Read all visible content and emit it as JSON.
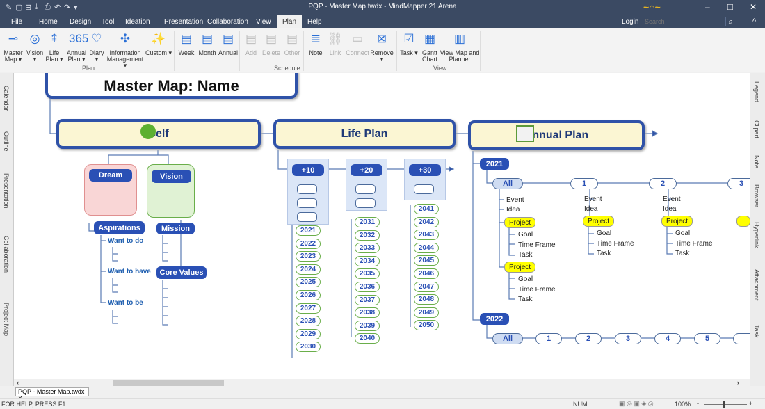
{
  "window": {
    "title": "PQP - Master Map.twdx - MindMapper 21 Arena",
    "minimize": "–",
    "maximize": "□",
    "close": "✕",
    "logo": "MindMapper logo"
  },
  "quick_access": [
    "✎",
    "▢",
    "⊟",
    "⤓",
    "⎙",
    "↶",
    "↷",
    "▾"
  ],
  "menu_tabs": [
    "File",
    "Home",
    "Design",
    "Tool",
    "Ideation",
    "Presentation",
    "Collaboration",
    "View",
    "Plan",
    "Help"
  ],
  "active_tab": "Plan",
  "header": {
    "login": "Login",
    "search_placeholder": "Search",
    "search_icon": "⌕",
    "collapse": "^"
  },
  "ribbon": {
    "plan": {
      "label": "Plan",
      "buttons": [
        {
          "label": "Master Map ▾",
          "icon": "⊸"
        },
        {
          "label": "Vision ▾",
          "icon": "◎"
        },
        {
          "label": "Life Plan ▾",
          "icon": "⇞"
        },
        {
          "label": "Annual Plan ▾",
          "icon": "365"
        },
        {
          "label": "Diary ▾",
          "icon": "♡"
        },
        {
          "label": "Information Management ▾",
          "icon": "✣"
        },
        {
          "label": "Custom ▾",
          "icon": "✨"
        }
      ]
    },
    "schedule": {
      "label": "Schedule",
      "buttons": [
        {
          "label": "Week",
          "icon": "▤",
          "enabled": true
        },
        {
          "label": "Month",
          "icon": "▤",
          "enabled": true
        },
        {
          "label": "Annual",
          "icon": "▤",
          "enabled": true
        },
        {
          "label": "Add",
          "icon": "▤",
          "enabled": false
        },
        {
          "label": "Delete",
          "icon": "▤",
          "enabled": false
        },
        {
          "label": "Other",
          "icon": "▤",
          "enabled": false
        },
        {
          "label": "Note",
          "icon": "≣",
          "enabled": true
        },
        {
          "label": "Link",
          "icon": "⛓",
          "enabled": false
        },
        {
          "label": "Connect",
          "icon": "▭",
          "enabled": false
        },
        {
          "label": "Remove ▾",
          "icon": "⊠",
          "enabled": true
        }
      ]
    },
    "view": {
      "label": "View",
      "buttons": [
        {
          "label": "Task ▾",
          "icon": "☑"
        },
        {
          "label": "Gantt Chart",
          "icon": "▦"
        },
        {
          "label": "View Map and Planner",
          "icon": "▥"
        }
      ]
    }
  },
  "left_panel": [
    "Calendar",
    "Outline",
    "Presentation",
    "Collaboration",
    "Project Map"
  ],
  "right_panel": [
    "Legend",
    "Clipart",
    "Note",
    "Browser",
    "Hyperlink",
    "Attachment",
    "Task"
  ],
  "map": {
    "title": "Master Map: Name",
    "self": {
      "label": "Self",
      "dream": "Dream",
      "vision": "Vision",
      "aspirations": "Aspirations",
      "mission": "Mission",
      "core_values": "Core Values",
      "wants": [
        "Want to do",
        "Want to have",
        "Want to be"
      ]
    },
    "life_plan": {
      "label": "Life Plan",
      "columns": [
        {
          "label": "+10",
          "years": [
            "2021",
            "2022",
            "2023",
            "2024",
            "2025",
            "2026",
            "2027",
            "2028",
            "2029",
            "2030"
          ]
        },
        {
          "label": "+20",
          "years": [
            "2031",
            "2032",
            "2033",
            "2034",
            "2035",
            "2036",
            "2037",
            "2038",
            "2039",
            "2040"
          ]
        },
        {
          "label": "+30",
          "years": [
            "2041",
            "2042",
            "2043",
            "2044",
            "2045",
            "2046",
            "2047",
            "2048",
            "2049",
            "2050"
          ]
        }
      ]
    },
    "annual_plan": {
      "label": "Annual Plan",
      "year1": {
        "label": "2021",
        "months": [
          "All",
          "1",
          "2",
          "3"
        ],
        "event": "Event",
        "idea": "Idea",
        "project": "Project",
        "project_items": [
          "Goal",
          "Time Frame",
          "Task"
        ]
      },
      "year2": {
        "label": "2022",
        "months": [
          "All",
          "1",
          "2",
          "3",
          "4",
          "5",
          ""
        ]
      }
    }
  },
  "doc_tab": {
    "label": "PQP - Master Map.twdx",
    "close": "X"
  },
  "status": {
    "help": "FOR HELP, PRESS F1",
    "num": "NUM",
    "zoom": "100%",
    "zoom_minus": "-",
    "zoom_plus": "+"
  },
  "colors": {
    "titlebar": "#3b4a63",
    "node_border": "#2f52a8",
    "node_fill": "#fbf6d3",
    "pill": "#2a50b5",
    "project": "#ffff00"
  }
}
